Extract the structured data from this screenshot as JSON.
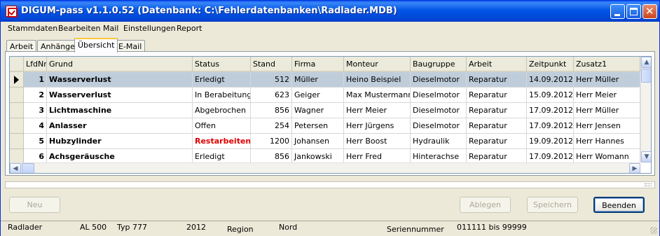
{
  "window": {
    "title": "DIGUM-pass v1.1.0.52 (Datenbank: C:\\Fehlerdatenbanken\\Radlader.MDB)",
    "close_glyph": "✕"
  },
  "menu": [
    "Stammdaten",
    "Bearbeiten",
    "Mail",
    "Einstellungen",
    "Report"
  ],
  "tabs": [
    {
      "label": "Arbeit"
    },
    {
      "label": "Anhänge"
    },
    {
      "label": "Übersicht",
      "active": true
    },
    {
      "label": "E-Mail"
    }
  ],
  "grid": {
    "columns": [
      "LfdNr",
      "Grund",
      "Status",
      "Stand",
      "Firma",
      "Monteur",
      "Baugruppe",
      "Arbeit",
      "Zeitpunkt",
      "Zusatz1"
    ],
    "rows": [
      {
        "lfdnr": "1",
        "grund": "Wasserverlust",
        "status": "Erledigt",
        "stand": "512",
        "firma": "Müller",
        "monteur": "Heino Beispiel",
        "baugruppe": "Dieselmotor",
        "arbeit": "Reparatur",
        "zeitpunkt": "14.09.2012",
        "zusatz1": "Herr Müller",
        "selected": true
      },
      {
        "lfdnr": "2",
        "grund": "Wasserverlust",
        "status": "In Berabeitung",
        "stand": "623",
        "firma": "Geiger",
        "monteur": "Max Mustermann",
        "baugruppe": "Dieselmotor",
        "arbeit": "Reparatur",
        "zeitpunkt": "15.09.2012",
        "zusatz1": "Herr Meier"
      },
      {
        "lfdnr": "3",
        "grund": "Lichtmaschine",
        "status": "Abgebrochen",
        "stand": "856",
        "firma": "Wagner",
        "monteur": "Herr Meier",
        "baugruppe": "Dieselmotor",
        "arbeit": "Reparatur",
        "zeitpunkt": "17.09.2012",
        "zusatz1": "Herr Müller"
      },
      {
        "lfdnr": "4",
        "grund": "Anlasser",
        "status": "Offen",
        "stand": "254",
        "firma": "Petersen",
        "monteur": "Herr Jürgens",
        "baugruppe": "Dieselmotor",
        "arbeit": "Reparatur",
        "zeitpunkt": "17.09.2012",
        "zusatz1": "Herr Jensen"
      },
      {
        "lfdnr": "5",
        "grund": "Hubzylinder",
        "status": "Restarbeiten",
        "stand": "1200",
        "firma": "Johansen",
        "monteur": "Herr Boost",
        "baugruppe": "Hydraulik",
        "arbeit": "Reparatur",
        "zeitpunkt": "19.09.2012",
        "zusatz1": "Herr Hannes",
        "status_color": "#e00000"
      },
      {
        "lfdnr": "6",
        "grund": "Achsgeräusche",
        "status": "Erledigt",
        "stand": "856",
        "firma": "Jankowski",
        "monteur": "Herr Fred",
        "baugruppe": "Hinterachse",
        "arbeit": "Reparatur",
        "zeitpunkt": "17.09.2012",
        "zusatz1": "Herr Womann"
      }
    ]
  },
  "scroll": {
    "up": "▲",
    "down": "▼",
    "left": "◀",
    "right": "▶"
  },
  "buttons": {
    "neu": "Neu",
    "ablegen": "Ablegen",
    "speichern": "Speichern",
    "beenden": "Beenden"
  },
  "status": {
    "type": "Radlader",
    "model": "AL 500",
    "typ": "Typ 777",
    "year": "2012",
    "region_label": "Region",
    "region_value": "Nord",
    "serial_label": "Seriennummer",
    "serial_value": "011111 bis 99999"
  },
  "colors": {
    "titlebar": "#0255e5",
    "selected_row": "#bfcddb",
    "restarbeiten": "#e00000",
    "tab_active_accent": "#ffc83c"
  }
}
